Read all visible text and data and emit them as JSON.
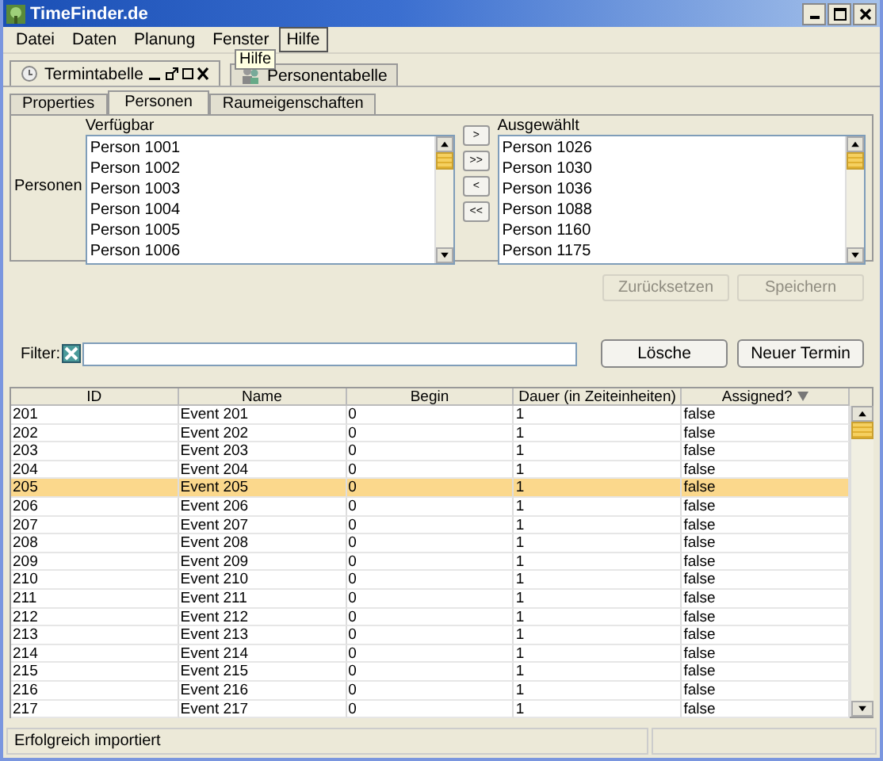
{
  "window": {
    "title": "TimeFinder.de"
  },
  "menu": [
    {
      "label": "Datei",
      "selected": false
    },
    {
      "label": "Daten",
      "selected": false
    },
    {
      "label": "Planung",
      "selected": false
    },
    {
      "label": "Fenster",
      "selected": false
    },
    {
      "label": "Hilfe",
      "selected": true
    }
  ],
  "tooltip": "Hilfe",
  "doc_tabs": [
    {
      "label": "Termintabelle",
      "selected": true
    },
    {
      "label": "Personentabelle",
      "selected": false
    }
  ],
  "tabs": [
    {
      "label": "Properties",
      "selected": false
    },
    {
      "label": "Personen",
      "selected": true
    },
    {
      "label": "Raumeigenschaften",
      "selected": false
    }
  ],
  "persons": {
    "label": "Personen",
    "available": {
      "heading": "Verfügbar",
      "items": [
        "Person 1001",
        "Person 1002",
        "Person 1003",
        "Person 1004",
        "Person 1005",
        "Person 1006"
      ]
    },
    "chosen": {
      "heading": "Ausgewählt",
      "items": [
        "Person 1026",
        "Person 1030",
        "Person 1036",
        "Person 1088",
        "Person 1160",
        "Person 1175"
      ]
    },
    "move_buttons": [
      ">",
      ">>",
      "<",
      "<<"
    ]
  },
  "action_buttons": [
    {
      "label": "Zurücksetzen",
      "disabled": true
    },
    {
      "label": "Speichern",
      "disabled": true
    }
  ],
  "filter": {
    "label": "Filter:",
    "buttons": [
      "Lösche",
      "Neuer Termin"
    ]
  },
  "table": {
    "columns": [
      {
        "label": "ID",
        "sorted": false
      },
      {
        "label": "Name",
        "sorted": false
      },
      {
        "label": "Begin",
        "sorted": false
      },
      {
        "label": "Dauer (in Zeiteinheiten)",
        "sorted": false
      },
      {
        "label": "Assigned?",
        "sorted": true
      }
    ],
    "rows": [
      {
        "cells": [
          "201",
          "Event 201",
          "0",
          "1",
          "false"
        ],
        "selected": false
      },
      {
        "cells": [
          "202",
          "Event 202",
          "0",
          "1",
          "false"
        ],
        "selected": false
      },
      {
        "cells": [
          "203",
          "Event 203",
          "0",
          "1",
          "false"
        ],
        "selected": false
      },
      {
        "cells": [
          "204",
          "Event 204",
          "0",
          "1",
          "false"
        ],
        "selected": false
      },
      {
        "cells": [
          "205",
          "Event 205",
          "0",
          "1",
          "false"
        ],
        "selected": true
      },
      {
        "cells": [
          "206",
          "Event 206",
          "0",
          "1",
          "false"
        ],
        "selected": false
      },
      {
        "cells": [
          "207",
          "Event 207",
          "0",
          "1",
          "false"
        ],
        "selected": false
      },
      {
        "cells": [
          "208",
          "Event 208",
          "0",
          "1",
          "false"
        ],
        "selected": false
      },
      {
        "cells": [
          "209",
          "Event 209",
          "0",
          "1",
          "false"
        ],
        "selected": false
      },
      {
        "cells": [
          "210",
          "Event 210",
          "0",
          "1",
          "false"
        ],
        "selected": false
      },
      {
        "cells": [
          "211",
          "Event 211",
          "0",
          "1",
          "false"
        ],
        "selected": false
      },
      {
        "cells": [
          "212",
          "Event 212",
          "0",
          "1",
          "false"
        ],
        "selected": false
      },
      {
        "cells": [
          "213",
          "Event 213",
          "0",
          "1",
          "false"
        ],
        "selected": false
      },
      {
        "cells": [
          "214",
          "Event 214",
          "0",
          "1",
          "false"
        ],
        "selected": false
      },
      {
        "cells": [
          "215",
          "Event 215",
          "0",
          "1",
          "false"
        ],
        "selected": false
      },
      {
        "cells": [
          "216",
          "Event 216",
          "0",
          "1",
          "false"
        ],
        "selected": false
      },
      {
        "cells": [
          "217",
          "Event 217",
          "0",
          "1",
          "false"
        ],
        "selected": false
      }
    ]
  },
  "status_bar": "Erfolgreich importiert"
}
